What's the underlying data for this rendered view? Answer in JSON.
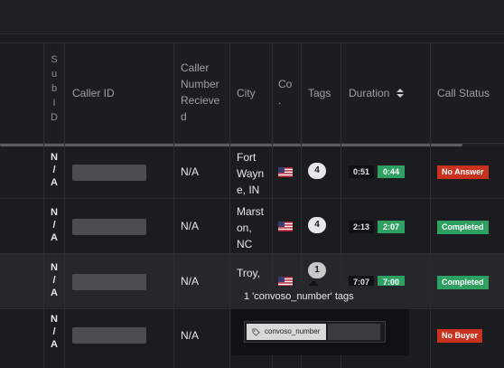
{
  "columns": {
    "sub_id": [
      "S",
      "u",
      "b",
      "I",
      "D"
    ],
    "caller_id": "Caller ID",
    "caller_number_received": [
      "Caller",
      "Number",
      "Recieve",
      "d"
    ],
    "city": "City",
    "country": [
      "Co",
      "."
    ],
    "tags": "Tags",
    "duration": "Duration",
    "call_status": "Call Status"
  },
  "rows": [
    {
      "sub_id": [
        "N",
        "/",
        "A"
      ],
      "caller_number_received": "N/A",
      "city": [
        "Fort",
        "Wayn",
        "e, IN"
      ],
      "tags_count": "4",
      "duration_total": "0:51",
      "duration_billed": "0:44",
      "call_status": "No Answer",
      "status_color": "#c8321f"
    },
    {
      "sub_id": [
        "N",
        "/",
        "A"
      ],
      "caller_number_received": "N/A",
      "city": [
        "Marst",
        "on,",
        "NC"
      ],
      "tags_count": "4",
      "duration_total": "2:13",
      "duration_billed": "2:07",
      "call_status": "Completed",
      "status_color": "#2ea061"
    },
    {
      "sub_id": [
        "N",
        "/",
        "A"
      ],
      "caller_number_received": "N/A",
      "city": [
        "Troy,"
      ],
      "tags_count": "1",
      "duration_total": "7:07",
      "duration_billed": "7:00",
      "call_status": "Completed",
      "status_color": "#2ea061"
    },
    {
      "sub_id": [
        "N",
        "/",
        "A"
      ],
      "caller_number_received": "N/A",
      "city": [],
      "tags_count": "",
      "duration_total": "",
      "duration_billed": "",
      "call_status": "No Buyer",
      "status_color": "#c8321f"
    }
  ],
  "tooltip": {
    "title": "1 'convoso_number' tags",
    "chip_label": "convoso_number",
    "chip_icon": "tag-icon"
  },
  "icons": {
    "sort": "sort-icon",
    "flag": "us-flag-icon"
  },
  "colors": {
    "red": "#c8321f",
    "green": "#2ea061"
  }
}
